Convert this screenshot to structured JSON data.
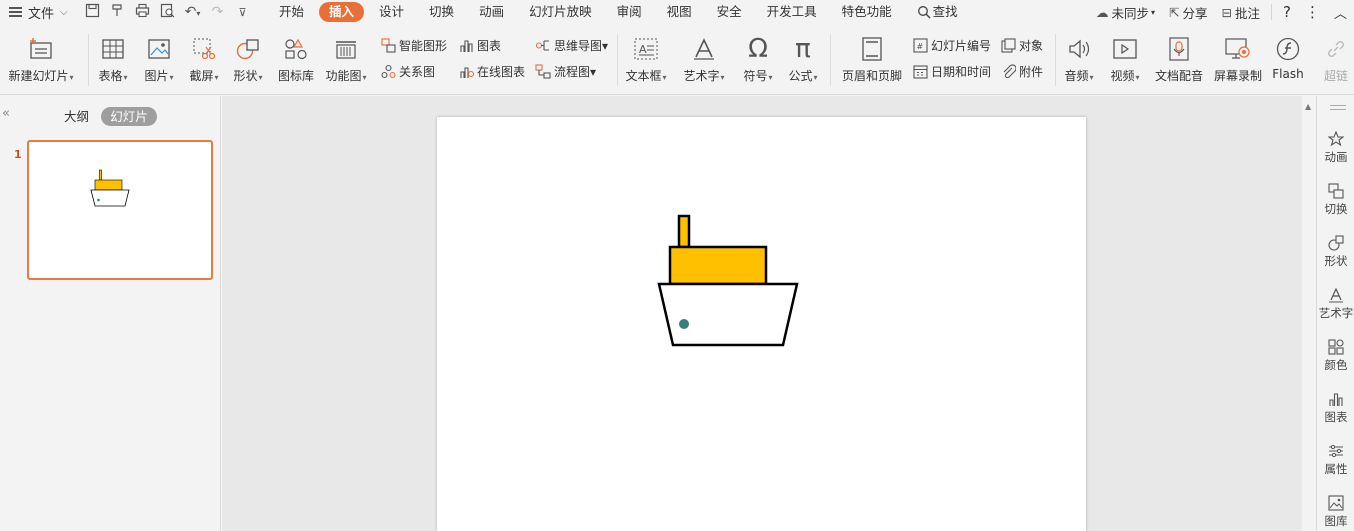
{
  "menu": {
    "file_label": "文件",
    "tabs": [
      "开始",
      "插入",
      "设计",
      "切换",
      "动画",
      "幻灯片放映",
      "审阅",
      "视图",
      "安全",
      "开发工具",
      "特色功能"
    ],
    "active_tab": "插入",
    "search_label": "查找",
    "sync_label": "未同步",
    "share_label": "分享",
    "comment_label": "批注"
  },
  "ribbon": {
    "new_slide": "新建幻灯片",
    "table": "表格",
    "picture": "图片",
    "screenshot": "截屏",
    "shape": "形状",
    "icon_lib": "图标库",
    "func_chart": "功能图",
    "smart_art": "智能图形",
    "chart": "图表",
    "relation": "关系图",
    "online_chart": "在线图表",
    "mindmap": "思维导图",
    "flowchart": "流程图",
    "textbox": "文本框",
    "wordart": "艺术字",
    "symbol": "符号",
    "formula": "公式",
    "header_footer": "页眉和页脚",
    "slide_number": "幻灯片编号",
    "object": "对象",
    "datetime": "日期和时间",
    "attachment": "附件",
    "audio": "音频",
    "video": "视频",
    "doc_voice": "文档配音",
    "screen_record": "屏幕录制",
    "flash": "Flash",
    "hyperlink": "超链"
  },
  "left_panel": {
    "outline_tab": "大纲",
    "slides_tab": "幻灯片",
    "slide_number": "1"
  },
  "right_panel": {
    "items": [
      "动画",
      "切换",
      "形状",
      "艺术字",
      "颜色",
      "图表",
      "属性",
      "图库"
    ]
  },
  "colors": {
    "accent": "#e96e38",
    "ship_body": "#ffc000",
    "porthole": "#3a7d7f",
    "outline": "#000000"
  }
}
